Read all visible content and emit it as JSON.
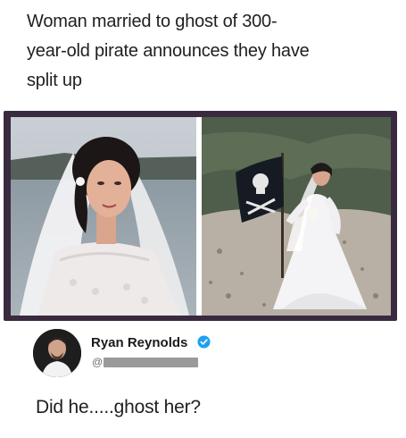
{
  "headline": {
    "line1": "Woman married to ghost of 300-",
    "line2": "year-old pirate announces they have",
    "line3": "split up"
  },
  "photos": {
    "left": {
      "subject": "bride in lace wedding dress and veil by the sea"
    },
    "right": {
      "subject": "bride in white dress holding a skull-and-crossbones pirate flag on a beach"
    }
  },
  "tweet": {
    "user_name": "Ryan Reynolds",
    "verified": true,
    "handle_prefix": "@",
    "text": "Did he.....ghost her?"
  },
  "colors": {
    "frame": "#3a2a40",
    "verified": "#1da1f2",
    "redaction": "#9a9a9a"
  }
}
